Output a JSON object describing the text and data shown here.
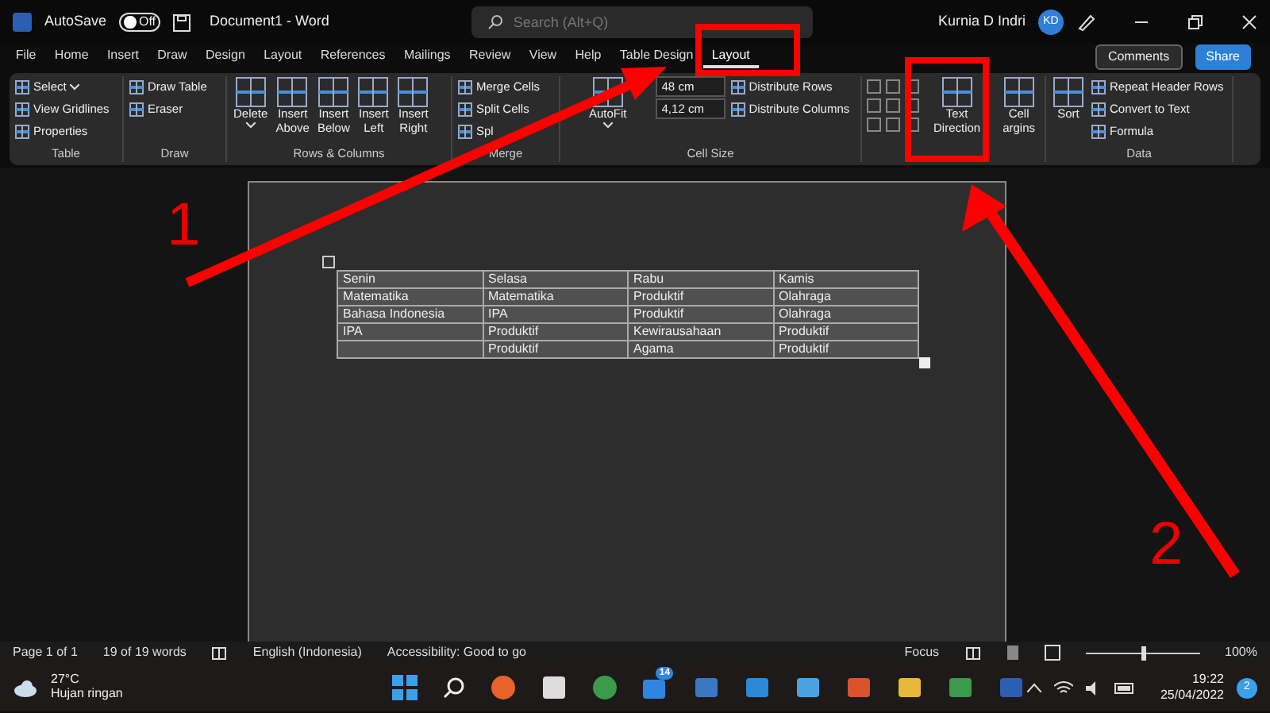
{
  "title_bar": {
    "autosave_label": "AutoSave",
    "autosave_on": false,
    "autosave_state": "Off",
    "document_title": "Document1  -  Word",
    "search_placeholder": "Search (Alt+Q)",
    "user_name": "Kurnia D Indri",
    "user_initials": "KD"
  },
  "tabs": [
    {
      "label": "File",
      "selected": false
    },
    {
      "label": "Home",
      "selected": false
    },
    {
      "label": "Insert",
      "selected": false
    },
    {
      "label": "Draw",
      "selected": false
    },
    {
      "label": "Design",
      "selected": false
    },
    {
      "label": "Layout",
      "selected": false
    },
    {
      "label": "References",
      "selected": false
    },
    {
      "label": "Mailings",
      "selected": false
    },
    {
      "label": "Review",
      "selected": false
    },
    {
      "label": "View",
      "selected": false
    },
    {
      "label": "Help",
      "selected": false
    },
    {
      "label": "Table Design",
      "selected": false
    },
    {
      "label": "Layout",
      "selected": true
    }
  ],
  "comments_button": "Comments",
  "share_button": "Share",
  "ribbon_groups": [
    {
      "label": "Table",
      "items": [
        {
          "kind": "small",
          "label": "Select",
          "dropdown": true
        },
        {
          "kind": "small",
          "label": "View Gridlines"
        },
        {
          "kind": "small",
          "label": "Properties"
        }
      ]
    },
    {
      "label": "Draw",
      "items": [
        {
          "kind": "small",
          "label": "Draw Table"
        },
        {
          "kind": "small",
          "label": "Eraser"
        }
      ]
    },
    {
      "label": "Rows & Columns",
      "items": [
        {
          "kind": "large",
          "lines": [
            "Delete"
          ],
          "dropdown": true
        },
        {
          "kind": "large",
          "lines": [
            "Insert",
            "Above"
          ]
        },
        {
          "kind": "large",
          "lines": [
            "Insert",
            "Below"
          ]
        },
        {
          "kind": "large",
          "lines": [
            "Insert",
            "Left"
          ]
        },
        {
          "kind": "large",
          "lines": [
            "Insert",
            "Right"
          ]
        }
      ]
    },
    {
      "label": "Merge",
      "items": [
        {
          "kind": "small",
          "label": "Merge Cells"
        },
        {
          "kind": "small",
          "label": "Split Cells"
        },
        {
          "kind": "small",
          "label": "Spl"
        }
      ]
    },
    {
      "label": "Cell Size",
      "items": [
        {
          "kind": "large",
          "lines": [
            "AutoFit"
          ],
          "dropdown": true
        },
        {
          "kind": "field",
          "value": "48 cm"
        },
        {
          "kind": "field",
          "value": "4,12 cm"
        },
        {
          "kind": "small",
          "label": "Distribute Rows"
        },
        {
          "kind": "small",
          "label": "Distribute Columns"
        }
      ]
    },
    {
      "items": [
        {
          "kind": "align_grid"
        },
        {
          "kind": "large",
          "lines": [
            "Text",
            "Direction"
          ]
        },
        {
          "kind": "large",
          "lines": [
            "Cell",
            "argins"
          ]
        }
      ]
    },
    {
      "label": "Data",
      "items": [
        {
          "kind": "large",
          "lines": [
            "Sort"
          ]
        },
        {
          "kind": "small",
          "label": "Repeat Header Rows"
        },
        {
          "kind": "small",
          "label": "Convert to Text"
        },
        {
          "kind": "small",
          "label": "Formula"
        }
      ]
    }
  ],
  "table": {
    "rows": [
      [
        "Senin",
        "Selasa",
        "Rabu",
        "Kamis"
      ],
      [
        "Matematika",
        "Matematika",
        "Produktif",
        "Olahraga"
      ],
      [
        "Bahasa Indonesia",
        "IPA",
        "Produktif",
        "Olahraga"
      ],
      [
        "IPA",
        "Produktif",
        "Kewirausahaan",
        "Produktif"
      ],
      [
        "",
        "Produktif",
        "Agama",
        "Produktif"
      ]
    ]
  },
  "status_bar": {
    "page": "Page 1 of 1",
    "words": "19 of 19 words",
    "language": "English (Indonesia)",
    "accessibility": "Accessibility: Good to go",
    "focus": "Focus",
    "zoom_slider": {
      "level": 0.5
    },
    "zoom": "100%"
  },
  "taskbar": {
    "temperature": "27°C",
    "weather": "Hujan ringan",
    "mail_badge": "14",
    "time": "19:22",
    "date": "25/04/2022",
    "notifications": "2"
  },
  "annotations": [
    {
      "label": "1"
    },
    {
      "label": "2"
    }
  ]
}
